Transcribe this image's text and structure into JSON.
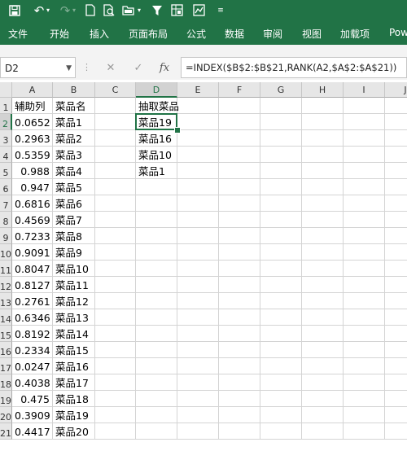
{
  "quick_access": {
    "icons": [
      "save-icon",
      "undo-icon",
      "undo-dropdown-icon",
      "redo-icon",
      "redo-dropdown-icon",
      "new-file-icon",
      "print-preview-icon",
      "open-icon",
      "open-dropdown-icon",
      "filter-icon",
      "freeze-panes-icon",
      "chart-icon",
      "customize-dropdown-icon"
    ]
  },
  "ribbon": {
    "tabs": [
      "文件",
      "开始",
      "插入",
      "页面布局",
      "公式",
      "数据",
      "审阅",
      "视图",
      "加载项",
      "Pow"
    ]
  },
  "formula_bar": {
    "name_box": "D2",
    "formula": "=INDEX($B$2:$B$21,RANK(A2,$A$2:$A$21))",
    "fx_label": "fx"
  },
  "columns": [
    "A",
    "B",
    "C",
    "D",
    "E",
    "F",
    "G",
    "H",
    "I",
    "J"
  ],
  "rows": [
    "1",
    "2",
    "3",
    "4",
    "5",
    "6",
    "7",
    "8",
    "9",
    "10",
    "11",
    "12",
    "13",
    "14",
    "15",
    "16",
    "17",
    "18",
    "19",
    "20",
    "21"
  ],
  "headers": {
    "A1": "辅助列",
    "B1": "菜品名",
    "D1": "抽取菜品"
  },
  "helper_values": [
    "0.0652",
    "0.2963",
    "0.5359",
    "0.988",
    "0.947",
    "0.6816",
    "0.4569",
    "0.7233",
    "0.9091",
    "0.8047",
    "0.8127",
    "0.2761",
    "0.6346",
    "0.8192",
    "0.2334",
    "0.0247",
    "0.4038",
    "0.475",
    "0.3909",
    "0.4417"
  ],
  "dish_names": [
    "菜品1",
    "菜品2",
    "菜品3",
    "菜品4",
    "菜品5",
    "菜品6",
    "菜品7",
    "菜品8",
    "菜品9",
    "菜品10",
    "菜品11",
    "菜品12",
    "菜品13",
    "菜品14",
    "菜品15",
    "菜品16",
    "菜品17",
    "菜品18",
    "菜品19",
    "菜品20"
  ],
  "drawn_dishes": [
    "菜品19",
    "菜品16",
    "菜品10",
    "菜品1"
  ],
  "selected_cell": "D2",
  "colors": {
    "accent": "#217346",
    "header_bg": "#e6e6e6",
    "gridline": "#d4d4d4"
  }
}
